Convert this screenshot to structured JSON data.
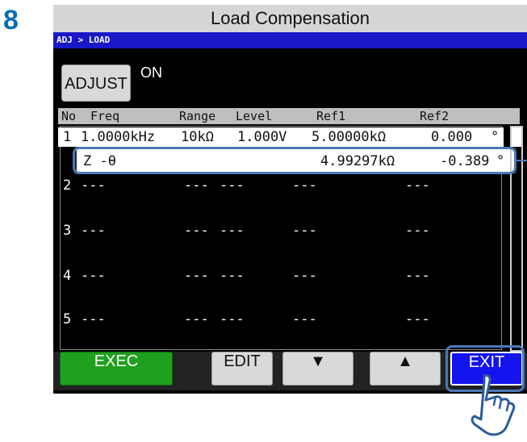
{
  "step": "8",
  "title": "Load Compensation",
  "breadcrumb": "ADJ > LOAD",
  "adjust": {
    "label": "ADJUST",
    "state": "ON"
  },
  "table": {
    "headers": [
      "No",
      "Freq",
      "Range",
      "Level",
      "Ref1",
      "Ref2"
    ],
    "rows": [
      {
        "no": "1",
        "freq": "1.0000kHz",
        "range": "10kΩ",
        "level": "1.000V",
        "ref1": "5.00000kΩ",
        "ref2": "0.000",
        "deg": "°"
      },
      {
        "no": "2",
        "freq": "---",
        "range": "---",
        "level": "---",
        "ref1": "---",
        "ref2": "---",
        "deg": ""
      },
      {
        "no": "3",
        "freq": "---",
        "range": "---",
        "level": "---",
        "ref1": "---",
        "ref2": "---",
        "deg": ""
      },
      {
        "no": "4",
        "freq": "---",
        "range": "---",
        "level": "---",
        "ref1": "---",
        "ref2": "---",
        "deg": ""
      },
      {
        "no": "5",
        "freq": "---",
        "range": "---",
        "level": "---",
        "ref1": "---",
        "ref2": "---",
        "deg": ""
      }
    ]
  },
  "popup": {
    "param": "Z -θ",
    "ref1": "4.99297kΩ",
    "ref2": "-0.389",
    "deg": "°"
  },
  "buttons": {
    "exec": "EXEC",
    "edit": "EDIT",
    "down": "▼",
    "up": "▲",
    "exit": "EXIT"
  },
  "colors": {
    "step": "#0b6db7",
    "breadcrumb_bg": "#1818c8",
    "exec": "#1fa01f",
    "exit": "#1414ee",
    "highlight": "#4a79b8"
  }
}
